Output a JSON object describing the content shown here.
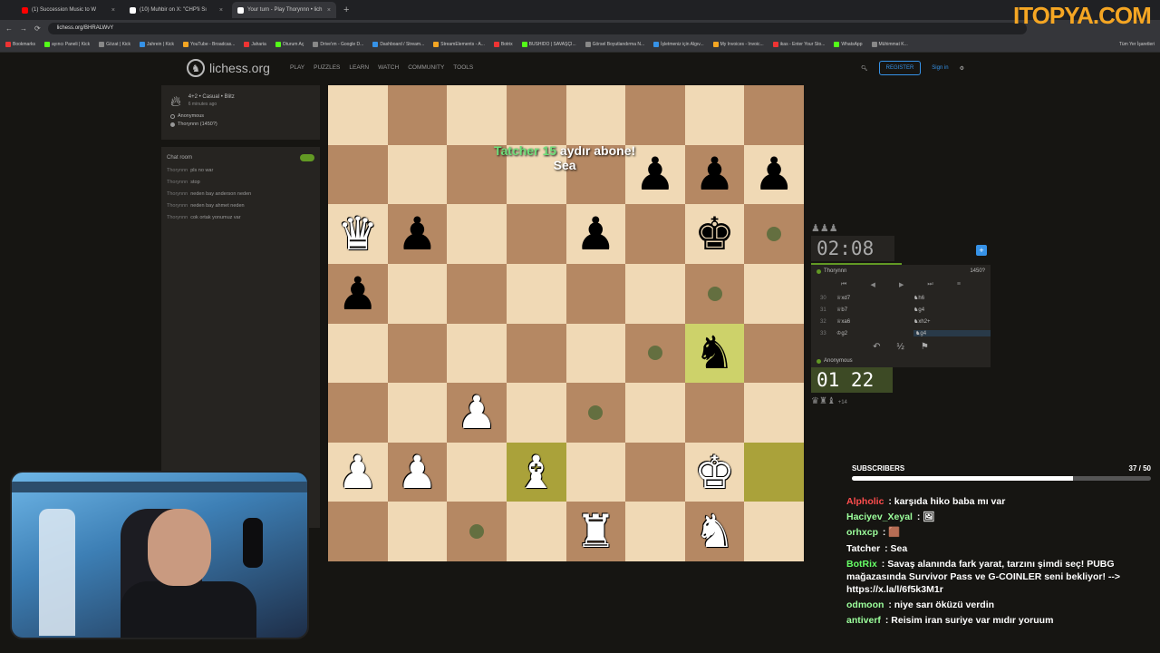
{
  "browser": {
    "tabs": [
      {
        "label": "(1) Succession Music to W",
        "color": "#ff0000",
        "active": false
      },
      {
        "label": "(10) Muhbir on X: \"CHP'li Sı",
        "color": "#ffffff",
        "active": false
      },
      {
        "label": "Your turn - Play Thorynnn • lich",
        "color": "#ffffff",
        "active": true
      }
    ],
    "new_tab": "+",
    "url": "lichess.org/BHRALWvY",
    "bookmarks": [
      "Bookmarks",
      "ayıncı Paneli | Kick",
      "Gözat | Kick",
      "Jahrein | Kick",
      "YouTube - Broadcas...",
      "Jaharia",
      "Oturum Aç",
      "Drive'ım - Google D...",
      "Dashboard / Stream...",
      "StreamElements - A...",
      "Botrix",
      "BUSHIDO | SAVAŞÇI...",
      "Görsel Boyutlandırma N...",
      "İşletmeniz için Algıv...",
      "My Invoices - Invoic...",
      "ikas - Enter Your Sto...",
      "WhatsApp",
      "Mühimmat K..."
    ],
    "bookmarks_right": "Tüm Yer İşaretleri"
  },
  "watermark": "ITOPYA.COM",
  "lichess": {
    "logo": "lichess.org",
    "nav": [
      "PLAY",
      "PUZZLES",
      "LEARN",
      "WATCH",
      "COMMUNITY",
      "TOOLS"
    ],
    "register": "REGISTER",
    "signin": "Sign in"
  },
  "game_info": {
    "mode": "4+2 • Casual • Blitz",
    "ago": "6 minutes ago",
    "white": "Anonymous",
    "black": "Thorynnn (1450?)"
  },
  "chat_room": {
    "title": "Chat room",
    "lines": [
      {
        "user": "Thorynnn",
        "text": "pls no war"
      },
      {
        "user": "Thorynnn",
        "text": "stop"
      },
      {
        "user": "Thorynnn",
        "text": "neden bay anderson neden"
      },
      {
        "user": "Thorynnn",
        "text": "neden bay ahmet neden"
      },
      {
        "user": "Thorynnn",
        "text": "cok ortak yonumuz var"
      }
    ]
  },
  "board": {
    "rows": [
      [
        "",
        "",
        "",
        "",
        "",
        "",
        "",
        ""
      ],
      [
        "",
        "",
        "",
        "",
        "",
        "bp",
        "bp",
        "bp"
      ],
      [
        "wq",
        "bp",
        "",
        "",
        "bp",
        "",
        "bk",
        "dot"
      ],
      [
        "bp",
        "",
        "",
        "",
        "",
        "",
        "dot",
        ""
      ],
      [
        "",
        "",
        "",
        "",
        "",
        "dot",
        "bn",
        ""
      ],
      [
        "",
        "",
        "wp",
        "",
        "dot",
        "",
        "",
        ""
      ],
      [
        "wp",
        "wp",
        "",
        "wb",
        "",
        "",
        "wk",
        ""
      ],
      [
        "",
        "",
        "dot",
        "",
        "wr",
        "",
        "wn",
        ""
      ]
    ],
    "highlights": [
      "4-6",
      "6-3",
      "6-7"
    ]
  },
  "overlay": {
    "name": "Tatcher",
    "months": "15",
    "text": "aydır abone!",
    "message": "Sea"
  },
  "clocks": {
    "opponent_time": "02:08",
    "opponent_name": "Thorynnn",
    "opponent_rating": "1450?",
    "my_time": "01 22",
    "my_name": "Anonymous",
    "my_captures": "+14",
    "opponent_captured": "♟♟♟",
    "my_captured": "♛♜♝"
  },
  "move_controls": [
    "⏮",
    "◀",
    "▶",
    "⏭",
    "≡"
  ],
  "moves": [
    {
      "n": "30",
      "w": "♕xd7",
      "b": "♞h6"
    },
    {
      "n": "31",
      "w": "♕b7",
      "b": "♞g4"
    },
    {
      "n": "32",
      "w": "♕xa6",
      "b": "♞xh2+"
    },
    {
      "n": "33",
      "w": "♔g2",
      "b": "♞g4"
    }
  ],
  "actions": [
    "↶",
    "½",
    "⚑"
  ],
  "subscribers": {
    "label": "SUBSCRIBERS",
    "count": "37 / 50",
    "progress": 0.74
  },
  "twitch_chat": [
    {
      "user": "Alpholic",
      "color": "#ff4d4d",
      "text": "karşıda hiko baba mı var"
    },
    {
      "user": "Haciyev_Xeyal",
      "color": "#9cff9c",
      "text": "🖼"
    },
    {
      "user": "orhxcp",
      "color": "#9cff9c",
      "text": "🟫"
    },
    {
      "user": "Tatcher",
      "color": "#ffffff",
      "text": "Sea"
    },
    {
      "user": "BotRix",
      "color": "#66ff66",
      "text": "Savaş alanında fark yarat, tarzını şimdi seç! PUBG mağazasında Survivor Pass ve G-COINLER seni bekliyor! --> https://x.la/l/6f5k3M1r"
    },
    {
      "user": "odmoon",
      "color": "#9cff9c",
      "text": "niye sarı öküzü verdin"
    },
    {
      "user": "antiverf",
      "color": "#9cff9c",
      "text": "Reisim iran suriye var mıdır yoruum"
    }
  ]
}
